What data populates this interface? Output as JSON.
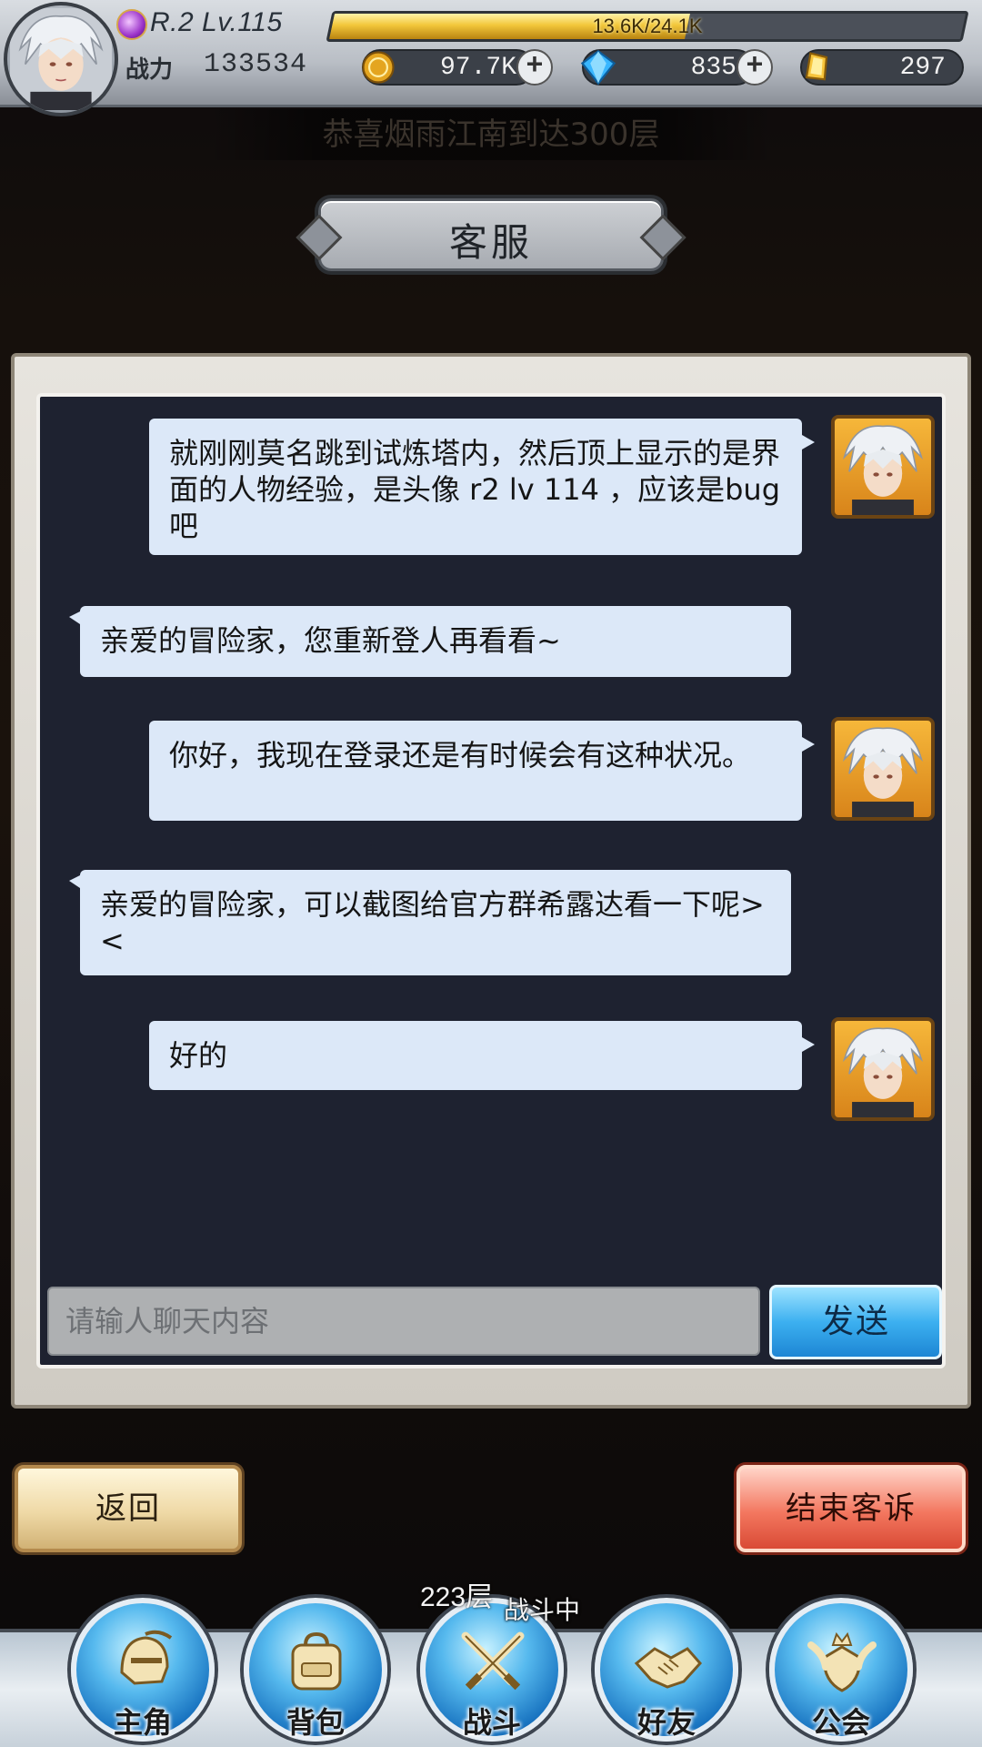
{
  "hud": {
    "level_text": "R.2 Lv.115",
    "exp_text": "13.6K/24.1K",
    "exp_fraction": 0.564,
    "power_label": "战力",
    "power_value": "133534",
    "gold": "97.7K",
    "diamond": "835",
    "gem": "297"
  },
  "notice": {
    "text": "恭喜烟雨江南到达300层"
  },
  "title": "客服",
  "chat": {
    "messages": [
      {
        "from": "me",
        "text": "就刚刚莫名跳到试炼塔内，然后顶上显示的是界面的人物经验，是头像 r2 lv 114 ，应该是bug吧"
      },
      {
        "from": "cs",
        "text": "亲爱的冒险家，您重新登人再看看~"
      },
      {
        "from": "me",
        "text": "你好，我现在登录还是有时候会有这种状况。"
      },
      {
        "from": "cs",
        "text": "亲爱的冒险家，可以截图给官方群希露达看一下呢><"
      },
      {
        "from": "me",
        "text": "好的"
      }
    ],
    "input_placeholder": "请输人聊天内容",
    "send_label": "发送"
  },
  "actions": {
    "back_label": "返回",
    "end_label": "结束客诉"
  },
  "nav": {
    "floor_text": "223层",
    "battle_status": "战斗中",
    "items": [
      {
        "label": "主角",
        "icon": "helmet-icon"
      },
      {
        "label": "背包",
        "icon": "backpack-icon"
      },
      {
        "label": "战斗",
        "icon": "crossed-swords-icon"
      },
      {
        "label": "好友",
        "icon": "handshake-icon"
      },
      {
        "label": "公会",
        "icon": "guild-crest-icon"
      }
    ]
  },
  "colors": {
    "bubble": "#dce8f8",
    "chat_bg": "#1e2230",
    "send_button": "#3cb0f0",
    "end_button": "#f3775f",
    "back_button": "#efd9a6",
    "avatar_frame": "#f6b73a"
  }
}
